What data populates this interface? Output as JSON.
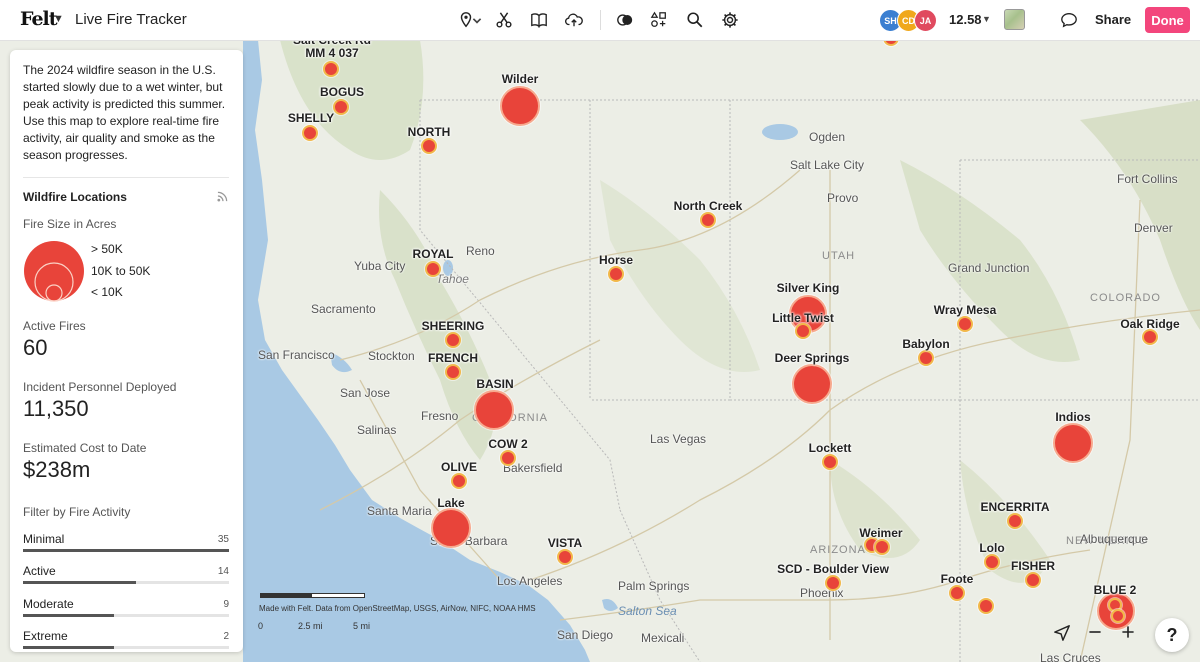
{
  "header": {
    "logo": "Felt",
    "map_title": "Live Fire Tracker",
    "tools": [
      "pin-icon",
      "scissors-icon",
      "book-icon",
      "upload-cloud-icon",
      "compare-icon",
      "elements-icon",
      "search-icon",
      "gear-icon"
    ],
    "collaborators": [
      {
        "initials": "SH",
        "color": "#3b7fd1"
      },
      {
        "initials": "CD",
        "color": "#f0a81c"
      },
      {
        "initials": "JA",
        "color": "#e04a5f"
      }
    ],
    "zoom": "12.58",
    "share_label": "Share",
    "done_label": "Done",
    "accent": "#f3467c"
  },
  "sidebar": {
    "intro": "The 2024 wildfire season in the U.S. started slowly due to a wet winter, but peak activity is predicted this summer. Use this map to explore real-time fire activity, air quality and smoke as the season progresses.",
    "layer_title": "Wildfire Locations",
    "legend_title": "Fire Size in Acres",
    "legend_items": [
      "> 50K",
      "10K to 50K",
      "< 10K"
    ],
    "stats": [
      {
        "label": "Active Fires",
        "value": "60"
      },
      {
        "label": "Incident Personnel Deployed",
        "value": "11,350"
      },
      {
        "label": "Estimated Cost to Date",
        "value": "$238m"
      }
    ],
    "filter_title": "Filter by Fire Activity",
    "filters": [
      {
        "name": "Minimal",
        "count": "35",
        "fraction": 1.0
      },
      {
        "name": "Active",
        "count": "14",
        "fraction": 0.55
      },
      {
        "name": "Moderate",
        "count": "9",
        "fraction": 0.44
      },
      {
        "name": "Extreme",
        "count": "2",
        "fraction": 0.44
      }
    ]
  },
  "map": {
    "fires": [
      {
        "name": "Salt Creek Rd MM 4 037"
      },
      {
        "name": "BOGUS"
      },
      {
        "name": "SHELLY"
      },
      {
        "name": "Wilder"
      },
      {
        "name": "NORTH"
      },
      {
        "name": "North Creek"
      },
      {
        "name": "ROYAL"
      },
      {
        "name": "Horse"
      },
      {
        "name": "Silver King"
      },
      {
        "name": "Little Twist"
      },
      {
        "name": "SHEERING"
      },
      {
        "name": "FRENCH"
      },
      {
        "name": "Deer Springs"
      },
      {
        "name": "BASIN"
      },
      {
        "name": "Babylon"
      },
      {
        "name": "Wray Mesa"
      },
      {
        "name": "Oak Ridge"
      },
      {
        "name": "COW 2"
      },
      {
        "name": "Indios"
      },
      {
        "name": "Lockett"
      },
      {
        "name": "OLIVE"
      },
      {
        "name": "Lake"
      },
      {
        "name": "VISTA"
      },
      {
        "name": "Weimer"
      },
      {
        "name": "SCD - Boulder View"
      },
      {
        "name": "ENCERRITA"
      },
      {
        "name": "Lolo"
      },
      {
        "name": "FISHER"
      },
      {
        "name": "Foote"
      },
      {
        "name": "BLUE 2"
      }
    ],
    "places": [
      "Ogden",
      "Salt Lake City",
      "Provo",
      "Fort Collins",
      "Denver",
      "Reno",
      "Yuba City",
      "Sacramento",
      "San Francisco",
      "Stockton",
      "San Jose",
      "Fresno",
      "Salinas",
      "Las Vegas",
      "Bakersfield",
      "Santa Maria",
      "Santa Barbara",
      "Los Angeles",
      "Palm Springs",
      "San Diego",
      "Mexicali",
      "Phoenix",
      "Albuquerque",
      "Grand Junction",
      "Tahoe",
      "Las Cruces"
    ],
    "regions": [
      "UTAH",
      "COLORADO",
      "CALIFORNIA",
      "ARIZONA",
      "NEW MEXICO"
    ],
    "water": [
      "Salton Sea"
    ],
    "scale": {
      "zero": "0",
      "mid": "2.5 mi",
      "max": "5 mi"
    },
    "attribution": "Made with Felt. Data from OpenStreetMap, USGS, AirNow, NIFC, NOAA HMS"
  },
  "controls": {
    "help": "?"
  }
}
